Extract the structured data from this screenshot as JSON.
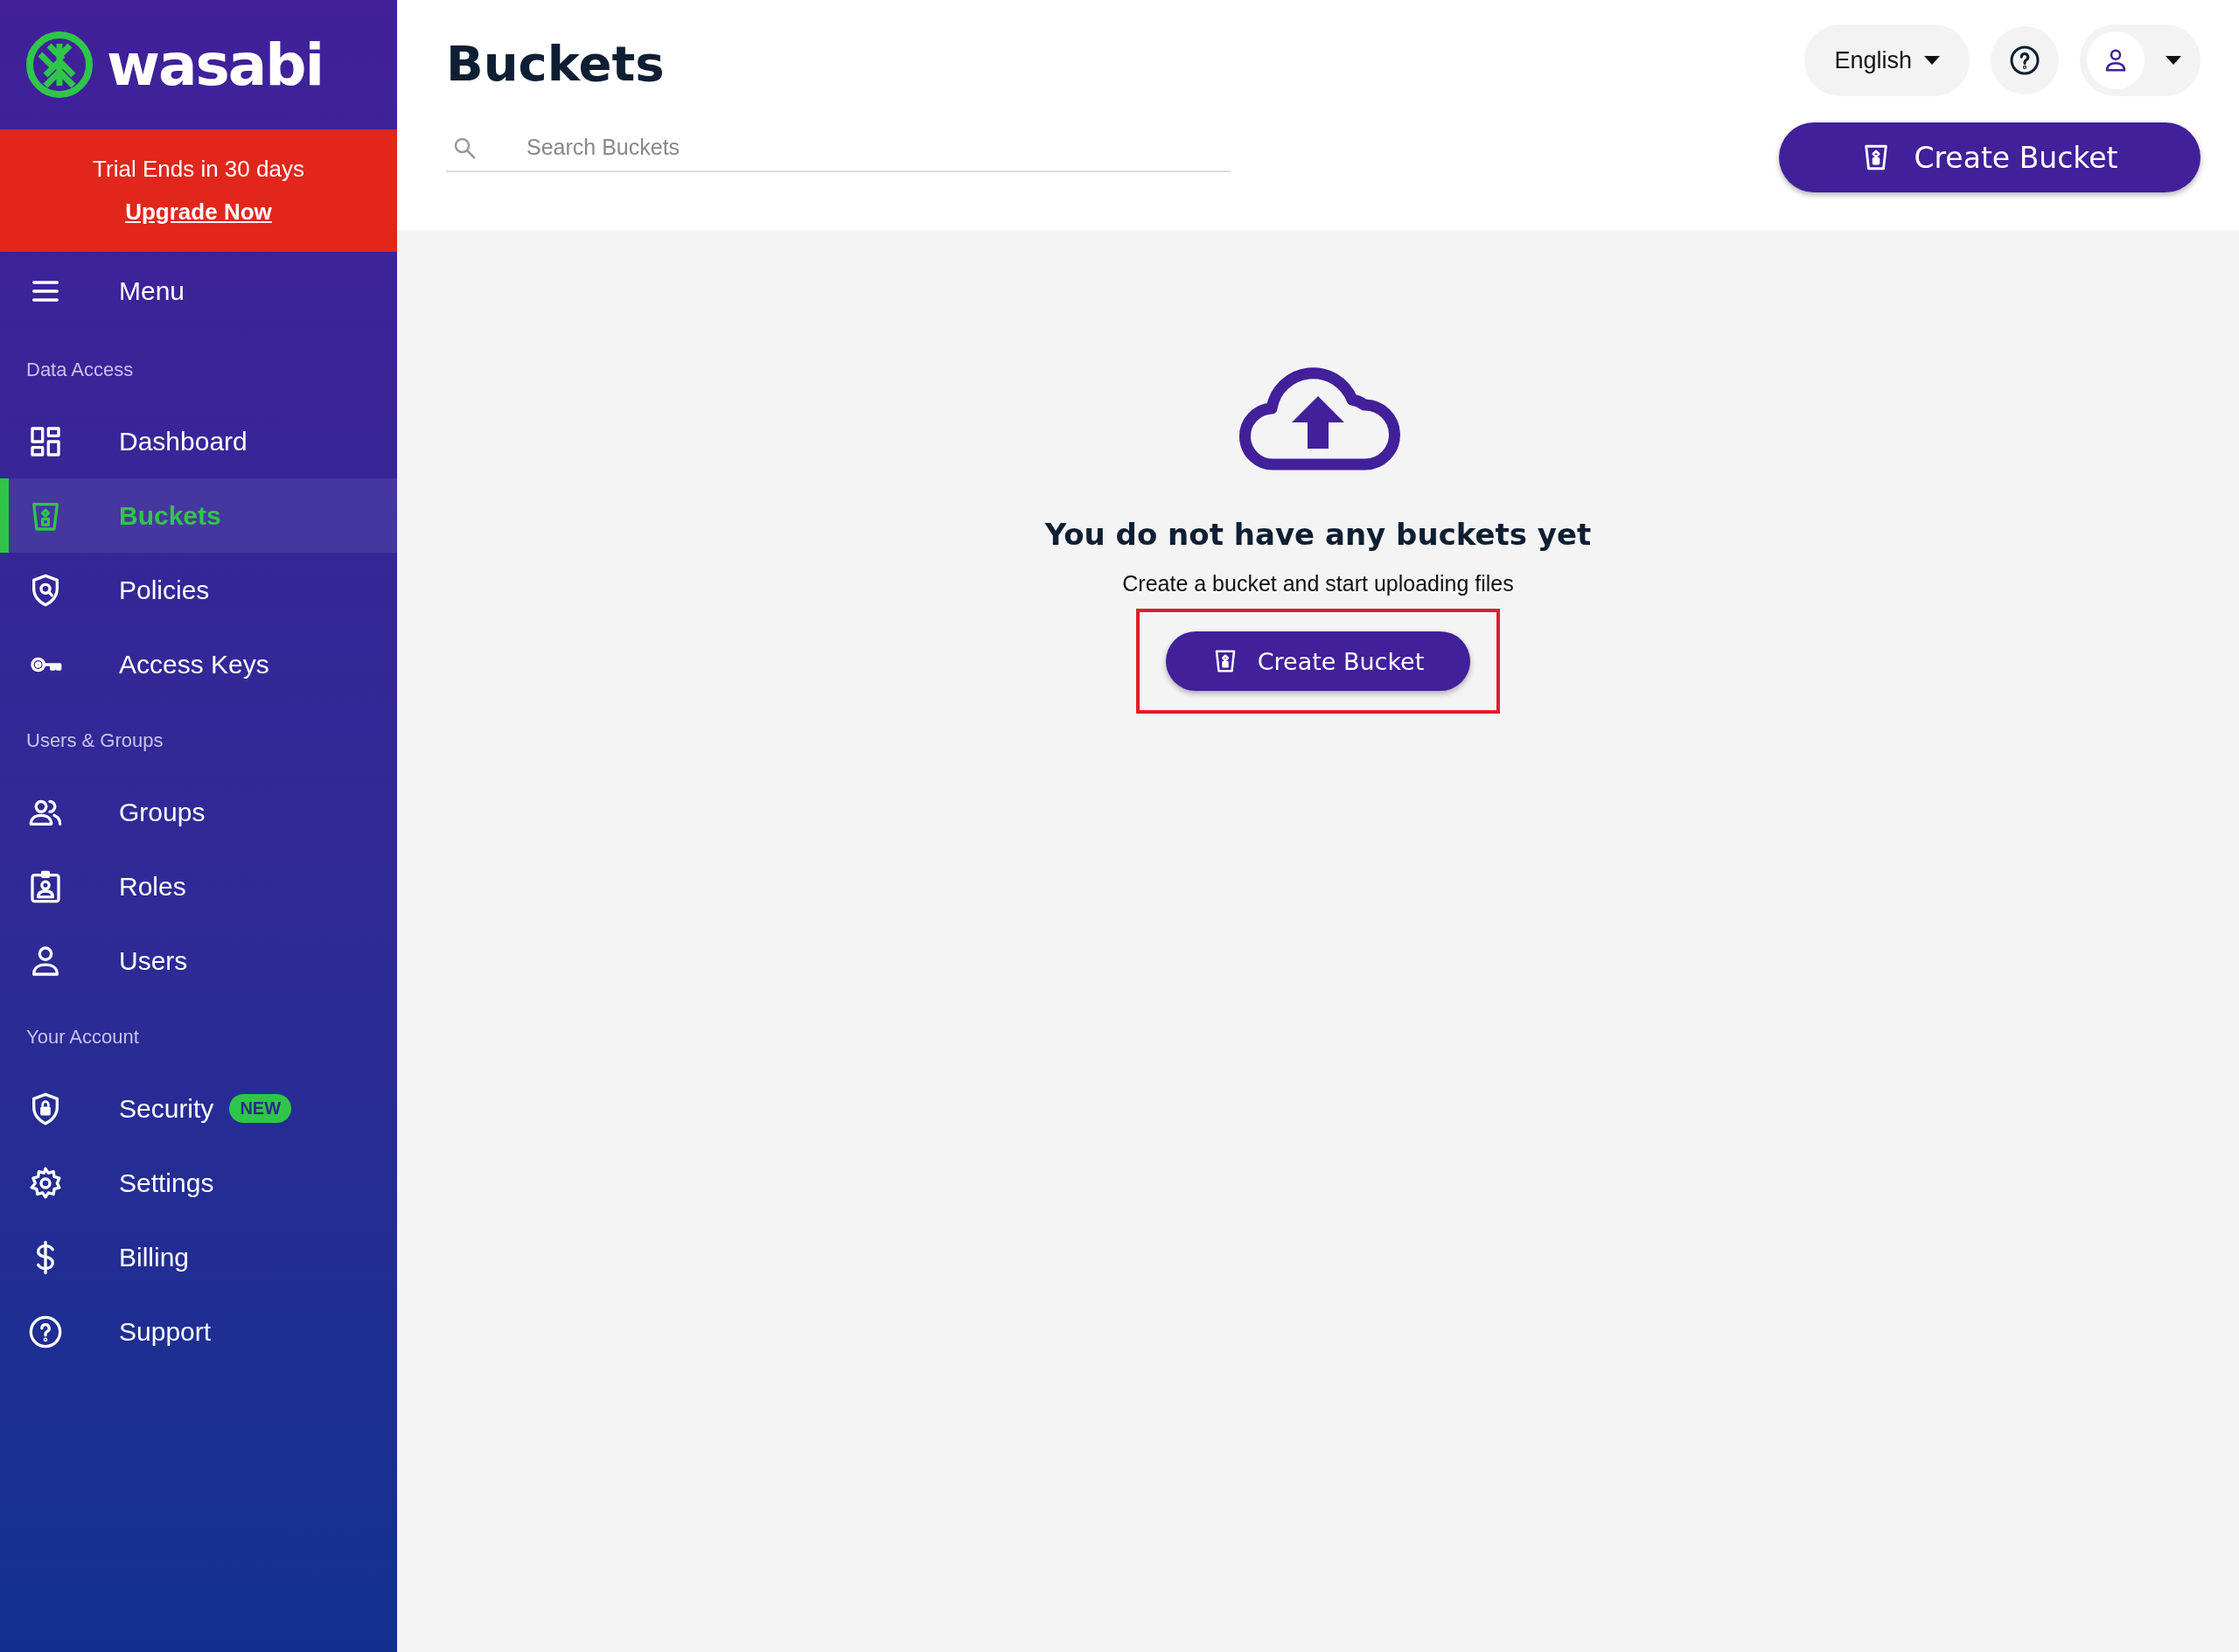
{
  "sidebar": {
    "logo": "wasabi",
    "trial": {
      "text": "Trial Ends in 30 days",
      "link": "Upgrade Now"
    },
    "menu": "Menu",
    "sections": [
      {
        "title": "Data Access",
        "items": [
          {
            "label": "Dashboard",
            "selected": false
          },
          {
            "label": "Buckets",
            "selected": true
          },
          {
            "label": "Policies",
            "selected": false
          },
          {
            "label": "Access Keys",
            "selected": false
          }
        ]
      },
      {
        "title": "Users & Groups",
        "items": [
          {
            "label": "Groups",
            "selected": false
          },
          {
            "label": "Roles",
            "selected": false
          },
          {
            "label": "Users",
            "selected": false
          }
        ]
      },
      {
        "title": "Your Account",
        "items": [
          {
            "label": "Security",
            "selected": false,
            "badge": "NEW"
          },
          {
            "label": "Settings",
            "selected": false
          },
          {
            "label": "Billing",
            "selected": false
          },
          {
            "label": "Support",
            "selected": false
          }
        ]
      }
    ]
  },
  "header": {
    "title": "Buckets",
    "search": {
      "placeholder": "Search Buckets"
    },
    "language": "English",
    "create_button": "Create Bucket"
  },
  "empty_state": {
    "heading": "You do not have any buckets yet",
    "text": "Create a bucket and start uploading files",
    "button": "Create Bucket",
    "highlighted": true
  }
}
